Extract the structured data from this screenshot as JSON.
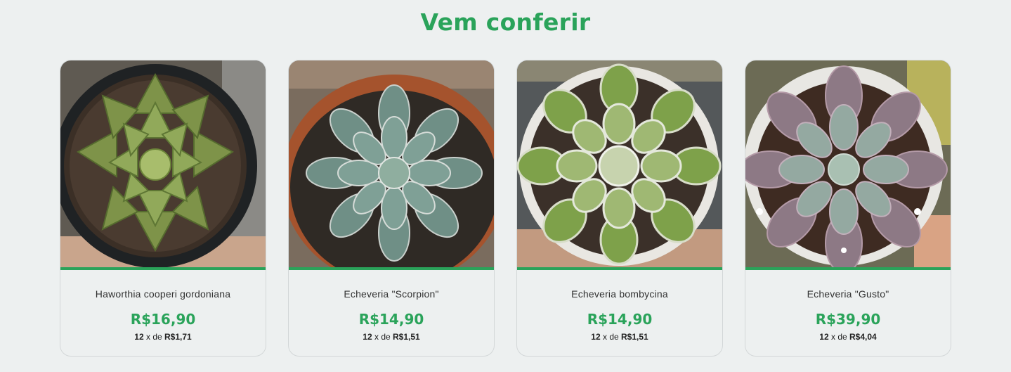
{
  "section": {
    "title": "Vem conferir"
  },
  "products": [
    {
      "name": "Haworthia cooperi gordoniana",
      "price": "R$16,90",
      "installment_count": "12",
      "installment_separator": "x de",
      "installment_value": "R$1,71",
      "image_icon": "haworthia-succulent-photo"
    },
    {
      "name": "Echeveria \"Scorpion\"",
      "price": "R$14,90",
      "installment_count": "12",
      "installment_separator": "x de",
      "installment_value": "R$1,51",
      "image_icon": "echeveria-scorpion-photo"
    },
    {
      "name": "Echeveria bombycina",
      "price": "R$14,90",
      "installment_count": "12",
      "installment_separator": "x de",
      "installment_value": "R$1,51",
      "image_icon": "echeveria-bombycina-photo"
    },
    {
      "name": "Echeveria \"Gusto\"",
      "price": "R$39,90",
      "installment_count": "12",
      "installment_separator": "x de",
      "installment_value": "R$4,04",
      "image_icon": "echeveria-gusto-photo"
    }
  ],
  "colors": {
    "accent": "#2aa35a",
    "background": "#edf0f0"
  }
}
